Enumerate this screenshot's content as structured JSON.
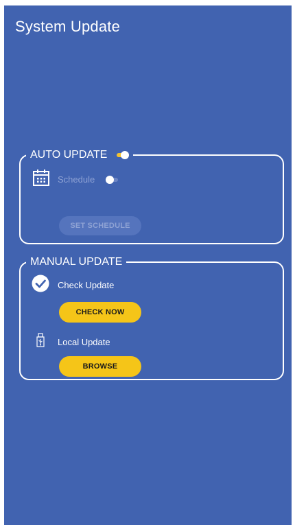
{
  "header": {
    "title": "System Update"
  },
  "auto_update": {
    "legend": "AUTO UPDATE",
    "toggle_state": "on",
    "schedule": {
      "label": "Schedule",
      "toggle_state": "off",
      "icon": "calendar-icon"
    },
    "set_schedule_label": "SET SCHEDULE"
  },
  "manual_update": {
    "legend": "MANUAL UPDATE",
    "check_update": {
      "label": "Check Update",
      "icon": "check-circle-icon",
      "button_label": "CHECK NOW"
    },
    "local_update": {
      "label": "Local Update",
      "icon": "usb-icon",
      "button_label": "BROWSE"
    }
  },
  "colors": {
    "background": "#4163b0",
    "accent": "#f5c518",
    "text": "#ffffff"
  }
}
